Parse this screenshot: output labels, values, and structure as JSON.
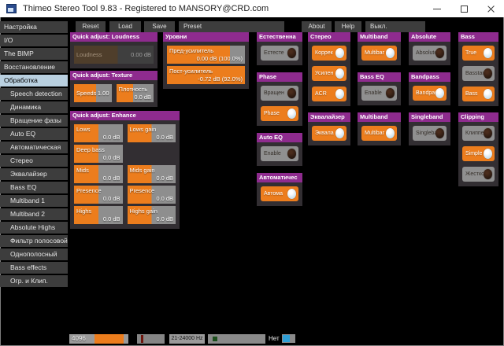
{
  "window": {
    "title": "Thimeo Stereo Tool 9.83 - Registered to MANSORY@CRD.com"
  },
  "toolbar": {
    "reset": "Reset",
    "load": "Load",
    "save": "Save",
    "preset": "Preset",
    "about": "About",
    "help": "Help",
    "power": "Выкл."
  },
  "sidebar": {
    "items": [
      {
        "label": "Настройка",
        "indent": false,
        "selected": false
      },
      {
        "label": "I/O",
        "indent": false,
        "selected": false
      },
      {
        "label": "The BIMP",
        "indent": false,
        "selected": false
      },
      {
        "label": "Восстановление",
        "indent": false,
        "selected": false
      },
      {
        "label": "Обработка",
        "indent": false,
        "selected": true
      },
      {
        "label": "Speech detection",
        "indent": true,
        "selected": false
      },
      {
        "label": "Динамика",
        "indent": true,
        "selected": false
      },
      {
        "label": "Вращение фазы",
        "indent": true,
        "selected": false
      },
      {
        "label": "Auto EQ",
        "indent": true,
        "selected": false
      },
      {
        "label": "Автоматическая",
        "indent": true,
        "selected": false
      },
      {
        "label": "Стерео",
        "indent": true,
        "selected": false
      },
      {
        "label": "Эквалайзер",
        "indent": true,
        "selected": false
      },
      {
        "label": "Bass EQ",
        "indent": true,
        "selected": false
      },
      {
        "label": "Multiband 1",
        "indent": true,
        "selected": false
      },
      {
        "label": "Multiband 2",
        "indent": true,
        "selected": false
      },
      {
        "label": "Absolute Highs",
        "indent": true,
        "selected": false
      },
      {
        "label": "Фильтр полосовой",
        "indent": true,
        "selected": false
      },
      {
        "label": "Однополосный",
        "indent": true,
        "selected": false
      },
      {
        "label": "Bass effects",
        "indent": true,
        "selected": false
      },
      {
        "label": "Огр. и Клип.",
        "indent": true,
        "selected": false
      }
    ]
  },
  "columns": [
    {
      "panels": [
        {
          "title": "Quick adjust: Loudness",
          "controls": [
            {
              "type": "slider",
              "label": "Loudness",
              "value": "0.00 dB",
              "fill": 55,
              "lines": 1,
              "variant": "disabled"
            }
          ]
        },
        {
          "title": "Quick adjust: Texture",
          "controls": [
            {
              "type": "row",
              "items": [
                {
                  "type": "slider",
                  "label": "Speeds",
                  "value": "1.00",
                  "fill": 58,
                  "lines": 1,
                  "variant": "orange"
                },
                {
                  "type": "slider",
                  "label": "Плотность",
                  "value": "0.0 dB",
                  "fill": 45,
                  "lines": 2,
                  "variant": "orange"
                }
              ]
            }
          ]
        },
        {
          "title": "Quick adjust: Enhance",
          "controls": [
            {
              "type": "row",
              "items": [
                {
                  "type": "slider",
                  "label": "Lows",
                  "value": "0.0 dB",
                  "fill": 50,
                  "lines": 2,
                  "variant": "orange"
                },
                {
                  "type": "slider",
                  "label": "Lows gain",
                  "value": "0.0 dB",
                  "fill": 50,
                  "lines": 2,
                  "variant": "orange"
                }
              ]
            },
            {
              "type": "row",
              "items": [
                {
                  "type": "slider",
                  "label": "Deep bass",
                  "value": "0.0 dB",
                  "fill": 50,
                  "lines": 2,
                  "variant": "orange"
                }
              ]
            },
            {
              "type": "row",
              "items": [
                {
                  "type": "slider",
                  "label": "Mids",
                  "value": "0.0 dB",
                  "fill": 50,
                  "lines": 2,
                  "variant": "orange"
                },
                {
                  "type": "slider",
                  "label": "Mids gain",
                  "value": "0.0 dB",
                  "fill": 50,
                  "lines": 2,
                  "variant": "orange"
                }
              ]
            },
            {
              "type": "row",
              "items": [
                {
                  "type": "slider",
                  "label": "Presence",
                  "value": "0.0 dB",
                  "fill": 50,
                  "lines": 2,
                  "variant": "orange"
                },
                {
                  "type": "slider",
                  "label": "Presence",
                  "value": "0.0 dB",
                  "fill": 50,
                  "lines": 2,
                  "variant": "orange"
                }
              ]
            },
            {
              "type": "row",
              "items": [
                {
                  "type": "slider",
                  "label": "Highs",
                  "value": "0.0 dB",
                  "fill": 50,
                  "lines": 2,
                  "variant": "orange"
                },
                {
                  "type": "slider",
                  "label": "Highs gain",
                  "value": "0.0 dB",
                  "fill": 50,
                  "lines": 2,
                  "variant": "orange"
                }
              ]
            }
          ]
        }
      ]
    },
    {
      "panels": [
        {
          "title": "Уровни",
          "controls": [
            {
              "type": "slider",
              "label": "Пред-усилитель",
              "value": "0.00 dB (100.0%)",
              "fill": 81,
              "lines": 2,
              "variant": "orange"
            },
            {
              "type": "slider",
              "label": "Пост-усилитель",
              "value": "-0.72 dB (92.0%)",
              "fill": 100,
              "lines": 2,
              "variant": "orange"
            }
          ]
        }
      ]
    },
    {
      "panels": [
        {
          "title": "Естественна",
          "controls": [
            {
              "type": "toggle",
              "label": "Естесте",
              "on": false
            }
          ]
        },
        {
          "title": "Phase",
          "controls": [
            {
              "type": "toggle",
              "label": "Вращен",
              "on": false
            },
            {
              "type": "toggle",
              "label": "Phase",
              "on": true
            }
          ]
        },
        {
          "title": "Auto EQ",
          "controls": [
            {
              "type": "toggle",
              "label": "Enable",
              "on": false
            }
          ]
        },
        {
          "title": "Автоматичес",
          "controls": [
            {
              "type": "toggle",
              "label": "Автома",
              "on": true
            }
          ]
        }
      ]
    },
    {
      "panels": [
        {
          "title": "Стерео",
          "controls": [
            {
              "type": "toggle",
              "label": "Коррек",
              "on": true
            },
            {
              "type": "toggle",
              "label": "Усилен",
              "on": true
            },
            {
              "type": "toggle",
              "label": "ACR",
              "on": true
            }
          ]
        },
        {
          "title": "Эквалайзер",
          "controls": [
            {
              "type": "toggle",
              "label": "Эквала",
              "on": true
            }
          ]
        }
      ]
    },
    {
      "panels": [
        {
          "title": "Multiband",
          "controls": [
            {
              "type": "toggle",
              "label": "Multibar",
              "on": true
            }
          ]
        },
        {
          "title": "Bass EQ",
          "controls": [
            {
              "type": "toggle",
              "label": "Enable",
              "on": false
            }
          ]
        },
        {
          "title": "Multiband",
          "controls": [
            {
              "type": "toggle",
              "label": "Multibar",
              "on": true
            }
          ]
        }
      ]
    },
    {
      "panels": [
        {
          "title": "Absolute",
          "controls": [
            {
              "type": "toggle",
              "label": "Absolute",
              "on": false
            }
          ]
        },
        {
          "title": "Bandpass",
          "controls": [
            {
              "type": "toggle",
              "label": "Bandpass",
              "on": true
            }
          ]
        },
        {
          "title": "Singleband",
          "controls": [
            {
              "type": "toggle",
              "label": "Singleba",
              "on": false
            }
          ]
        }
      ]
    },
    {
      "panels": [
        {
          "title": "Bass",
          "controls": [
            {
              "type": "toggle",
              "label": "True",
              "on": true
            },
            {
              "type": "toggle",
              "label": "Basstar",
              "on": false
            },
            {
              "type": "toggle",
              "label": "Bass",
              "on": true
            }
          ]
        },
        {
          "title": "Clipping",
          "controls": [
            {
              "type": "toggle",
              "label": "Клиппе",
              "on": false
            },
            {
              "type": "toggle",
              "label": "Simple",
              "on": true
            },
            {
              "type": "toggle",
              "label": "Жестко",
              "on": false
            }
          ]
        }
      ]
    }
  ],
  "bottombar": {
    "fft_label": "4096",
    "hz_label": "21-24000 Hz",
    "none_label": "Нет"
  },
  "colors": {
    "accent_orange": "#ec7d1d",
    "accent_purple": "#8e2b8e",
    "panel_bg": "#322e32",
    "slider_gray": "#8e8e8e",
    "disabled_fill": "#4f3e2b",
    "disabled_track": "#3f3f3f",
    "toggle_off": "#909090",
    "selected_sidebar": "#b9d0e0",
    "blue_accent": "#2f9fd6"
  }
}
